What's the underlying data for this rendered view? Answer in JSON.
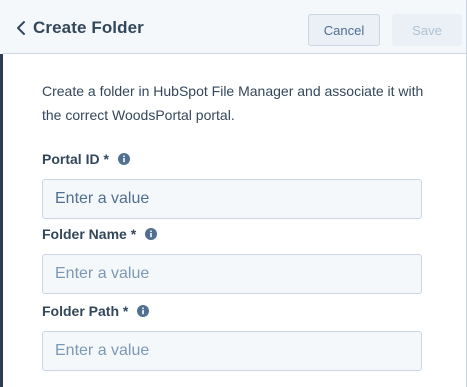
{
  "header": {
    "title": "Create Folder",
    "cancel_label": "Cancel",
    "save_label": "Save"
  },
  "description": "Create a folder in HubSpot File Manager and associate it with the correct WoodsPortal portal.",
  "fields": [
    {
      "label": "Portal ID *",
      "placeholder": "Enter a value",
      "value": ""
    },
    {
      "label": "Folder Name *",
      "placeholder": "Enter a value",
      "value": ""
    },
    {
      "label": "Folder Path *",
      "placeholder": "Enter a value",
      "value": ""
    }
  ],
  "icons": {
    "back": "chevron-left-icon",
    "info": "info-icon"
  },
  "colors": {
    "text": "#33475b",
    "header_bg": "#f5f8fa",
    "border": "#cbd6e2",
    "input_bg": "#f5f8fa",
    "button_bg": "#eaf0f6",
    "disabled_text": "#b0c1d4"
  }
}
